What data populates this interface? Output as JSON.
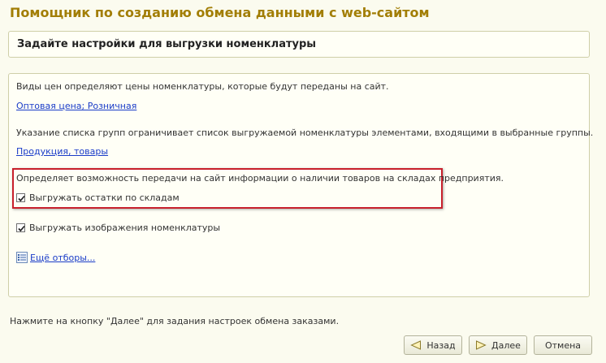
{
  "window": {
    "title": "Помощник по созданию обмена данными с web-сайтом"
  },
  "header": {
    "text": "Задайте настройки для выгрузки номенклатуры"
  },
  "main": {
    "price_types_desc": "Виды цен определяют цены номенклатуры, которые будут переданы на сайт.",
    "price_types_link": "Оптовая цена; Розничная",
    "groups_desc": "Указание списка групп ограничивает список выгружаемой номенклатуры элементами, входящими в выбранные группы.",
    "groups_link": "Продукция, товары",
    "stock_desc": "Определяет возможность передачи на сайт информации о наличии товаров на складах предприятия.",
    "stock_checkbox": {
      "label": "Выгружать остатки по складам",
      "checked": true
    },
    "images_checkbox": {
      "label": "Выгружать изображения номенклатуры",
      "checked": true
    },
    "more_filters_link": "Ещё отборы..."
  },
  "footer": {
    "hint": "Нажмите на кнопку \"Далее\" для задания настроек обмена заказами."
  },
  "buttons": {
    "back": "Назад",
    "next": "Далее",
    "cancel": "Отмена"
  },
  "colors": {
    "title": "#a27e05",
    "link": "#1a3cc8",
    "highlight": "#c8202c",
    "background": "#fbfbef"
  },
  "icons": {
    "back": "triangle-left-icon",
    "next": "triangle-right-icon",
    "filter": "filter-list-icon",
    "check": "checkmark-icon"
  }
}
